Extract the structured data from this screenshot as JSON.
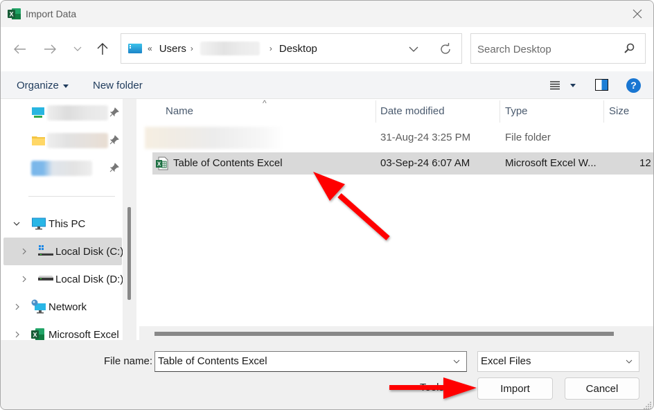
{
  "window": {
    "title": "Import Data",
    "app_icon": "excel-icon",
    "close_icon": "close-icon"
  },
  "navbar": {
    "back_icon": "arrow-left-icon",
    "forward_icon": "arrow-right-icon",
    "recent_icon": "chevron-down-icon",
    "up_icon": "arrow-up-icon",
    "breadcrumb": {
      "root_icon": "this-pc-icon",
      "overflow": "«",
      "items": [
        "Users",
        "[blurred]",
        "Desktop"
      ],
      "separator": "›"
    },
    "address_dropdown_icon": "chevron-down-icon",
    "refresh_icon": "refresh-icon",
    "search": {
      "placeholder": "Search Desktop",
      "value": "",
      "icon": "search-icon"
    }
  },
  "commandbar": {
    "organize_label": "Organize",
    "new_folder_label": "New folder",
    "view_icon": "list-view-icon",
    "preview_pane_icon": "preview-pane-icon",
    "help_label": "?"
  },
  "navpane": {
    "quick_access": [
      {
        "icon": "desktop-icon",
        "label": "[blurred]",
        "pinned": true
      },
      {
        "icon": "folder-icon",
        "label": "[blurred]",
        "pinned": true
      },
      {
        "icon": "cloud-icon",
        "label": "[blurred]",
        "pinned": true
      }
    ],
    "tree": [
      {
        "label": "This PC",
        "icon": "this-pc-icon",
        "expanded": true,
        "level": 0
      },
      {
        "label": "Local Disk (C:)",
        "icon": "windows-drive-icon",
        "expanded": false,
        "level": 1,
        "selected": true
      },
      {
        "label": "Local Disk (D:)",
        "icon": "drive-icon",
        "expanded": false,
        "level": 1
      },
      {
        "label": "Network",
        "icon": "network-icon",
        "expanded": false,
        "level": 0
      },
      {
        "label": "Microsoft Excel",
        "icon": "excel-icon",
        "expanded": false,
        "level": 0
      }
    ]
  },
  "filelist": {
    "columns": [
      "Name",
      "Date modified",
      "Type",
      "Size"
    ],
    "sort_column": "Name",
    "rows": [
      {
        "name": "[blurred]",
        "date": "31-Aug-24 3:25 PM",
        "type": "File folder",
        "size": "",
        "icon": "folder-icon"
      },
      {
        "name": "Table of Contents Excel",
        "date": "03-Sep-24 6:07 AM",
        "type": "Microsoft Excel W...",
        "size": "12",
        "icon": "excel-file-icon",
        "selected": true
      }
    ]
  },
  "footer": {
    "file_name_label": "File name:",
    "file_name_value": "Table of Contents Excel",
    "file_type_value": "Excel Files",
    "tools_label": "Tools",
    "import_label": "Import",
    "cancel_label": "Cancel"
  },
  "annotations": {
    "arrow_color": "#ff0000",
    "arrows": [
      "points-to-selected-file",
      "points-to-import-button"
    ]
  }
}
